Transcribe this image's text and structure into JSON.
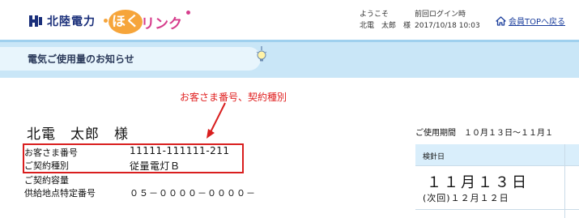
{
  "header": {
    "company_name": "北陸電力",
    "brand_a": "ほく",
    "brand_b": "リンク",
    "welcome_label": "ようこそ",
    "welcome_user": "北電　太郎　様",
    "last_login_label": "前回ログイン時",
    "last_login_value": "2017/10/18 10:03",
    "member_top_link": "会員TOPへ戻る",
    "icons": [
      "hokuriku-logo-icon",
      "home-icon"
    ],
    "colors": {
      "brand_orange": "#f6a53b",
      "brand_pink": "#d63d8c",
      "link_blue": "#1a3d9c"
    }
  },
  "banner": {
    "title": "電気ご使用量のお知らせ",
    "icon": "lightbulb-icon",
    "color": "#c9e6f7"
  },
  "annotation": {
    "text": "お客さま番号、契約種別",
    "color": "#e02020"
  },
  "customer": {
    "name": "北電　太郎　様",
    "rows": [
      {
        "label": "お客さま番号",
        "value": "11111-111111-211"
      },
      {
        "label": "ご契約種別",
        "value": "従量電灯Ｂ"
      },
      {
        "label": "ご契約容量",
        "value": ""
      },
      {
        "label": "供給地点特定番号",
        "value": "０５－００００－００００－"
      }
    ]
  },
  "usage": {
    "period": "ご使用期間　１０月１３日～１１月１",
    "column_header": "検針日",
    "read_date": "１１月１３日",
    "next_date": "(次回)１２月１２日"
  }
}
